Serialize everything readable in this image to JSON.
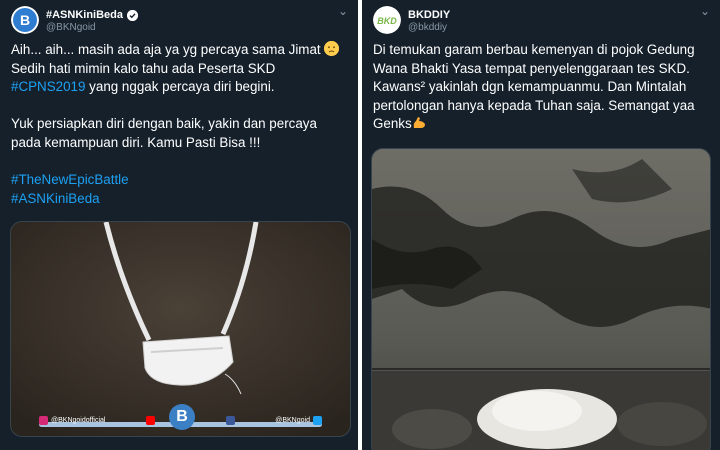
{
  "tweets": [
    {
      "display_name": "#ASNKiniBeda",
      "handle": "@BKNgoid",
      "lines": [
        "Aih... aih... masih ada aja ya yg percaya sama Jimat",
        "Sedih hati mimin kalo tahu ada Peserta SKD",
        " yang nggak percaya diri begini.",
        "Yuk persiapkan diri dengan baik, yakin dan percaya",
        "pada kemampuan diri. Kamu Pasti Bisa !!!"
      ],
      "inline_hashtag": "#CPNS2019",
      "hashtags": [
        "#TheNewEpicBattle",
        "#ASNKiniBeda"
      ],
      "avatar_letter": "B",
      "emoji": "disappointed-face",
      "media": {
        "description_icon": "amulet-photo",
        "social_bar": {
          "instagram": "@BKNgoidofficial",
          "twitter": "@BKNgoid"
        }
      }
    },
    {
      "display_name": "BKDDIY",
      "handle": "@bkddiy",
      "lines": [
        "Di temukan garam berbau kemenyan di pojok Gedung",
        "Wana Bhakti Yasa tempat penyelenggaraan tes SKD.",
        "Kawans² yakinlah dgn kemampuanmu. Dan Mintalah",
        "pertolongan hanya kepada Tuhan saja. Semangat yaa",
        "Genks"
      ],
      "avatar_letter": "BKD",
      "emoji": "flexed-biceps",
      "media": {
        "description_icon": "salt-pile-photo"
      }
    }
  ],
  "colors": {
    "background": "#15202b",
    "text": "#ffffff",
    "muted": "#8899a6",
    "link": "#1da1f2"
  }
}
